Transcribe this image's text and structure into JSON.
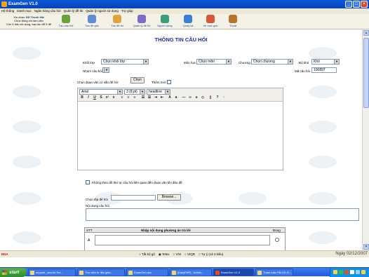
{
  "window": {
    "title": "ExamGen V1.0"
  },
  "menu": [
    "Hệ thống",
    "Danh mục",
    "Ngân hàng câu hỏi",
    "Quản lý đề thi",
    "Quản lý người sử dụng",
    "Trợ giúp"
  ],
  "welcome": {
    "line1": "Xin chào:",
    "name": "Đỗ Thanh Hải",
    "line2": "Chúc đồng chí làm việc",
    "line3": "Còn 5 dấu sử dụng, bao lần để 5 để"
  },
  "toolbar": [
    {
      "label": "Tạo câu hỏi",
      "icon": "people-icon",
      "color": "#6aa23a"
    },
    {
      "label": "Tạo đề gốc",
      "icon": "document-icon",
      "color": "#5b8ed6"
    },
    {
      "label": "Tạo đề thi",
      "icon": "exam-icon",
      "color": "#e0a53a"
    },
    {
      "label": "Quản lý đề thi",
      "icon": "manage-icon",
      "color": "#7c6cc4"
    },
    {
      "label": "Người dùng",
      "icon": "users-icon",
      "color": "#3c9c7c"
    },
    {
      "label": "Quay lại",
      "icon": "back-arrow-icon",
      "color": "#3b7fd8"
    },
    {
      "label": "Về mục gốc",
      "icon": "home-icon",
      "color": "#d65a3a"
    },
    {
      "label": "Thoát",
      "icon": "exit-door-icon",
      "color": "#b8742a"
    }
  ],
  "page": {
    "title": "THÔNG TIN CÂU HỎI"
  },
  "form": {
    "khoi_lop_label": "Khối lớp",
    "khoi_lop_value": "Chọn khối lớp",
    "mon_hoc_label": "Môn học",
    "mon_hoc_value": "Chọn môn",
    "chuong_label": "Chương",
    "chuong_value": "Chọn chương",
    "do_kho_label": "Độ khó",
    "do_kho_value": "Khó",
    "nhom_label": "Nhóm câu hỏi",
    "ma_label": "Mã câu hỏi",
    "ma_value": "100897",
    "chon_doan_label": "Chọn đoạn văn có sẵn để hỏi",
    "chon_button": "Chọn",
    "them_moi_label": "Thêm mới",
    "font_value": "Arial",
    "size_value": "3 (8 pt)",
    "heading_value": "headline",
    "no_link_label": "Không theo đồ thứ tự câu hỏi liên quan đến đoạn văn khi đảo đề",
    "chon_tep_label": "Chọn tệp để hỏi",
    "browse_button": "Browse...",
    "noi_dung_label": "Nội dung câu hỏi",
    "table_stt": "STT",
    "table_answer": "Nhập nội dung phương án trả lời",
    "table_correct": "Đúng",
    "row_a": "A"
  },
  "statusbar": {
    "left": "EDA",
    "options": [
      "Tắt bộ gõ",
      "Telex",
      "VNI",
      "VIQR",
      "Tự ý (cả 3 kiểu)"
    ],
    "date": "Ngày 02/12/2007"
  },
  "taskbar": {
    "start": "start",
    "tasks": [
      "mrpsetr_new.txt Tex...",
      "Thư viện tư liệu giáo...",
      "ExamGen.doc",
      "[EasyPHP] - Admin...",
      "ExamGen V1.0",
      "Tham luận PM IGI G..."
    ]
  },
  "colors": {
    "accent": "#1d2aa8",
    "titlebar": "#0742b8",
    "taskbar": "#2458d8"
  }
}
